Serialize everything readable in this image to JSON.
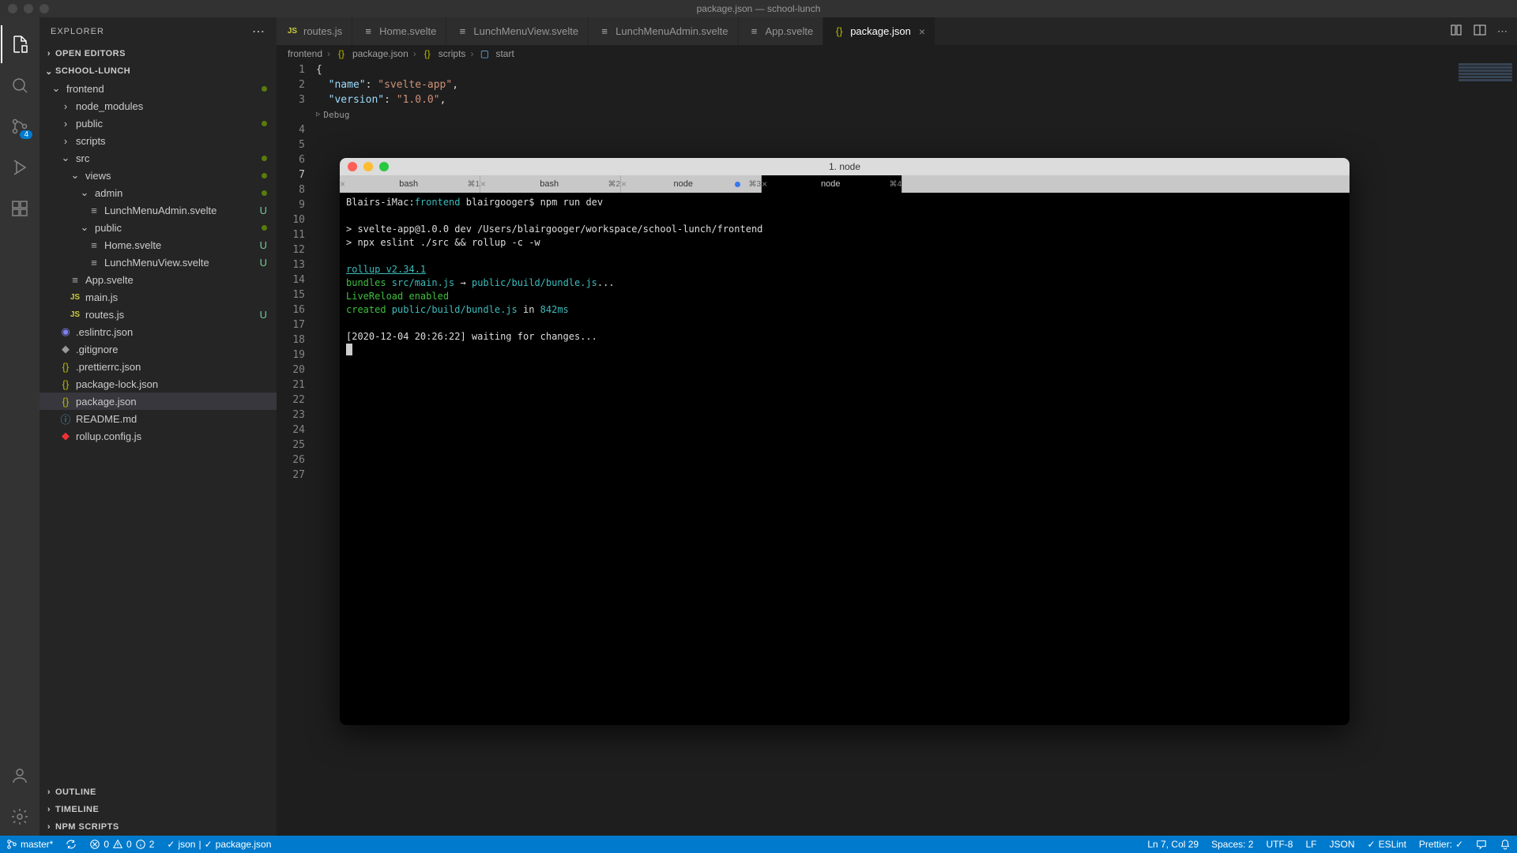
{
  "title_bar": {
    "title": "package.json — school-lunch"
  },
  "activity_bar": {
    "scm_badge": "4"
  },
  "sidebar": {
    "title": "EXPLORER",
    "sections": {
      "open_editors": "OPEN EDITORS",
      "workspace": "SCHOOL-LUNCH",
      "outline": "OUTLINE",
      "timeline": "TIMELINE",
      "npm_scripts": "NPM SCRIPTS"
    },
    "tree": [
      {
        "label": "frontend",
        "depth": 0,
        "kind": "folder-open",
        "git": "dot"
      },
      {
        "label": "node_modules",
        "depth": 1,
        "kind": "folder"
      },
      {
        "label": "public",
        "depth": 1,
        "kind": "folder",
        "git": "dot"
      },
      {
        "label": "scripts",
        "depth": 1,
        "kind": "folder"
      },
      {
        "label": "src",
        "depth": 1,
        "kind": "folder-open",
        "git": "dot"
      },
      {
        "label": "views",
        "depth": 2,
        "kind": "folder-open",
        "git": "dot"
      },
      {
        "label": "admin",
        "depth": 3,
        "kind": "folder-open",
        "git": "dot"
      },
      {
        "label": "LunchMenuAdmin.svelte",
        "depth": 4,
        "kind": "svelte",
        "git": "U"
      },
      {
        "label": "public",
        "depth": 3,
        "kind": "folder-open",
        "git": "dot"
      },
      {
        "label": "Home.svelte",
        "depth": 4,
        "kind": "svelte",
        "git": "U"
      },
      {
        "label": "LunchMenuView.svelte",
        "depth": 4,
        "kind": "svelte",
        "git": "U"
      },
      {
        "label": "App.svelte",
        "depth": 2,
        "kind": "svelte"
      },
      {
        "label": "main.js",
        "depth": 2,
        "kind": "js"
      },
      {
        "label": "routes.js",
        "depth": 2,
        "kind": "js",
        "git": "U"
      },
      {
        "label": ".eslintrc.json",
        "depth": 1,
        "kind": "eslint"
      },
      {
        "label": ".gitignore",
        "depth": 1,
        "kind": "git"
      },
      {
        "label": ".prettierrc.json",
        "depth": 1,
        "kind": "json"
      },
      {
        "label": "package-lock.json",
        "depth": 1,
        "kind": "json"
      },
      {
        "label": "package.json",
        "depth": 1,
        "kind": "json",
        "selected": true
      },
      {
        "label": "README.md",
        "depth": 1,
        "kind": "md"
      },
      {
        "label": "rollup.config.js",
        "depth": 1,
        "kind": "rollup"
      }
    ]
  },
  "editor": {
    "tabs": [
      {
        "label": "routes.js",
        "icon": "js"
      },
      {
        "label": "Home.svelte",
        "icon": "svelte"
      },
      {
        "label": "LunchMenuView.svelte",
        "icon": "svelte"
      },
      {
        "label": "LunchMenuAdmin.svelte",
        "icon": "svelte"
      },
      {
        "label": "App.svelte",
        "icon": "svelte"
      },
      {
        "label": "package.json",
        "icon": "json",
        "active": true,
        "close": true
      }
    ],
    "breadcrumbs": {
      "p0": "frontend",
      "p1": "package.json",
      "p2": "scripts",
      "p3": "start"
    },
    "codelens": "Debug",
    "code": {
      "l1": "{",
      "l2_k": "\"name\"",
      "l2_v": "\"svelte-app\"",
      "l3_k": "\"version\"",
      "l3_v": "\"1.0.0\""
    },
    "line_numbers": [
      "1",
      "2",
      "3",
      "",
      "4",
      "5",
      "6",
      "7",
      "8",
      "9",
      "10",
      "11",
      "12",
      "13",
      "14",
      "15",
      "16",
      "17",
      "18",
      "19",
      "20",
      "21",
      "22",
      "23",
      "24",
      "25",
      "26",
      "27"
    ],
    "active_line_idx": 7
  },
  "terminal": {
    "window_title": "1. node",
    "tabs": [
      {
        "label": "bash",
        "shortcut": "⌘1"
      },
      {
        "label": "bash",
        "shortcut": "⌘2"
      },
      {
        "label": "node",
        "shortcut": "⌘3",
        "dot": true
      },
      {
        "label": "node",
        "shortcut": "⌘4",
        "active": true
      }
    ],
    "lines": {
      "prompt_host": "Blairs-iMac:",
      "prompt_cwd": "frontend",
      "prompt_user": " blairgooger$ ",
      "prompt_cmd": "npm run dev",
      "l2": "> svelte-app@1.0.0 dev /Users/blairgooger/workspace/school-lunch/frontend",
      "l3": "> npx eslint ./src && rollup -c -w",
      "l5": "rollup v2.34.1",
      "l6a": "bundles ",
      "l6b": "src/main.js",
      "l6c": " → ",
      "l6d": "public/build/bundle.js",
      "l6e": "...",
      "l7": "LiveReload enabled",
      "l8a": "created ",
      "l8b": "public/build/bundle.js",
      "l8c": " in ",
      "l8d": "842ms",
      "l10": "[2020-12-04 20:26:22] waiting for changes..."
    }
  },
  "status_bar": {
    "branch": "master*",
    "errors": "0",
    "warnings": "0",
    "info": "2",
    "lsp1": "json",
    "lsp_sep": " | ",
    "lsp2": "package.json",
    "cursor": "Ln 7, Col 29",
    "spaces": "Spaces: 2",
    "encoding": "UTF-8",
    "eol": "LF",
    "lang": "JSON",
    "eslint": "ESLint",
    "prettier": "Prettier: "
  }
}
